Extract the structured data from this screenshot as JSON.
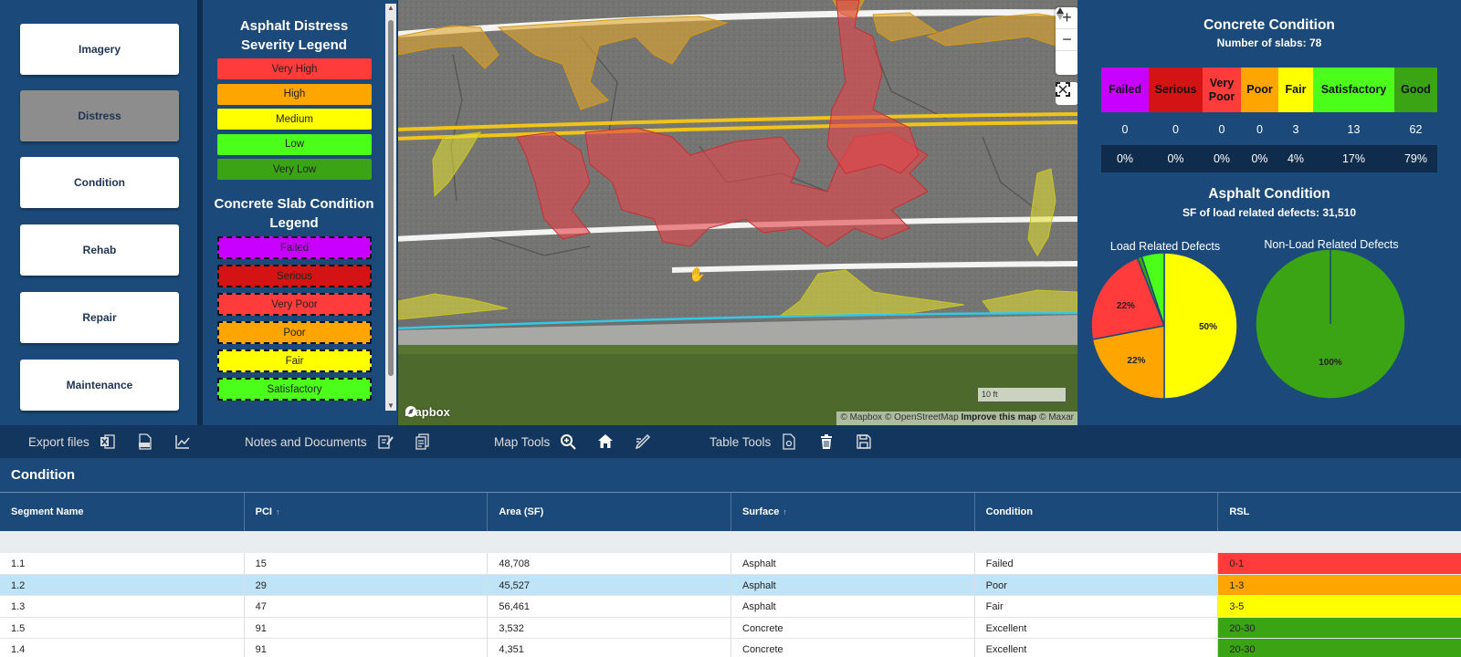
{
  "nav": {
    "items": [
      {
        "label": "Imagery",
        "active": false
      },
      {
        "label": "Distress",
        "active": true
      },
      {
        "label": "Condition",
        "active": false
      },
      {
        "label": "Rehab",
        "active": false
      },
      {
        "label": "Repair",
        "active": false
      },
      {
        "label": "Maintenance",
        "active": false
      }
    ]
  },
  "legend": {
    "asphalt_title": "Asphalt Distress Severity Legend",
    "asphalt_items": [
      {
        "label": "Very High",
        "color": "#ff3b3b"
      },
      {
        "label": "High",
        "color": "#ffa500"
      },
      {
        "label": "Medium",
        "color": "#ffff00"
      },
      {
        "label": "Low",
        "color": "#4cff1a"
      },
      {
        "label": "Very Low",
        "color": "#3aa414"
      }
    ],
    "slab_title": "Concrete Slab Condition Legend",
    "slab_items": [
      {
        "label": "Failed",
        "color": "#c800ff"
      },
      {
        "label": "Serious",
        "color": "#d41414"
      },
      {
        "label": "Very Poor",
        "color": "#ff3b3b"
      },
      {
        "label": "Poor",
        "color": "#ffa500"
      },
      {
        "label": "Fair",
        "color": "#ffff00"
      },
      {
        "label": "Satisfactory",
        "color": "#4cff1a"
      }
    ]
  },
  "map": {
    "logo": "mapbox",
    "attribution": "© Mapbox © OpenStreetMap",
    "attribution_link": "Improve this map",
    "attribution_tail": "© Maxar",
    "scale": "10 ft",
    "controls": {
      "zoom_in": "+",
      "zoom_out": "−"
    }
  },
  "concrete": {
    "title": "Concrete Condition",
    "subtitle": "Number of slabs: 78",
    "columns": [
      {
        "label": "Failed",
        "color": "#c800ff",
        "count": "0",
        "pct": "0%"
      },
      {
        "label": "Serious",
        "color": "#d41414",
        "count": "0",
        "pct": "0%"
      },
      {
        "label": "Very Poor",
        "color": "#ff3b3b",
        "count": "0",
        "pct": "0%"
      },
      {
        "label": "Poor",
        "color": "#ffa500",
        "count": "0",
        "pct": "0%"
      },
      {
        "label": "Fair",
        "color": "#ffff00",
        "count": "3",
        "pct": "4%"
      },
      {
        "label": "Satisfactory",
        "color": "#4cff1a",
        "count": "13",
        "pct": "17%"
      },
      {
        "label": "Good",
        "color": "#3aa414",
        "count": "62",
        "pct": "79%"
      }
    ]
  },
  "asphalt": {
    "title": "Asphalt Condition",
    "subtitle": "SF of load related defects: 31,510"
  },
  "chart_data": [
    {
      "type": "pie",
      "title": "Load Related Defects",
      "slices": [
        {
          "value": 50,
          "label": "50%",
          "color": "#ffff00"
        },
        {
          "value": 22,
          "label": "22%",
          "color": "#ffa500"
        },
        {
          "value": 22,
          "label": "22%",
          "color": "#ff3b3b"
        },
        {
          "value": 1,
          "label": "",
          "color": "#3aa414"
        },
        {
          "value": 5,
          "label": "",
          "color": "#4cff1a"
        }
      ]
    },
    {
      "type": "pie",
      "title": "Non-Load Related Defects",
      "slices": [
        {
          "value": 100,
          "label": "100%",
          "color": "#3aa414"
        }
      ]
    }
  ],
  "toolbar": {
    "export_label": "Export files",
    "notes_label": "Notes and Documents",
    "map_tools_label": "Map Tools",
    "table_tools_label": "Table Tools"
  },
  "table": {
    "title": "Condition",
    "columns": [
      {
        "label": "Segment Name",
        "sort": ""
      },
      {
        "label": "PCI",
        "sort": "↑"
      },
      {
        "label": "Area (SF)",
        "sort": ""
      },
      {
        "label": "Surface",
        "sort": "↑"
      },
      {
        "label": "Condition",
        "sort": ""
      },
      {
        "label": "RSL",
        "sort": ""
      }
    ],
    "rows": [
      {
        "segment": "1.1",
        "pci": "15",
        "area": "48,708",
        "surface": "Asphalt",
        "condition": "Failed",
        "rsl": "0-1",
        "rsl_color": "#ff3b3b",
        "selected": false
      },
      {
        "segment": "1.2",
        "pci": "29",
        "area": "45,527",
        "surface": "Asphalt",
        "condition": "Poor",
        "rsl": "1-3",
        "rsl_color": "#ffa500",
        "selected": true
      },
      {
        "segment": "1.3",
        "pci": "47",
        "area": "56,461",
        "surface": "Asphalt",
        "condition": "Fair",
        "rsl": "3-5",
        "rsl_color": "#ffff00",
        "selected": false
      },
      {
        "segment": "1.5",
        "pci": "91",
        "area": "3,532",
        "surface": "Concrete",
        "condition": "Excellent",
        "rsl": "20-30",
        "rsl_color": "#3aa414",
        "selected": false
      },
      {
        "segment": "1.4",
        "pci": "91",
        "area": "4,351",
        "surface": "Concrete",
        "condition": "Excellent",
        "rsl": "20-30",
        "rsl_color": "#3aa414",
        "selected": false
      }
    ]
  }
}
